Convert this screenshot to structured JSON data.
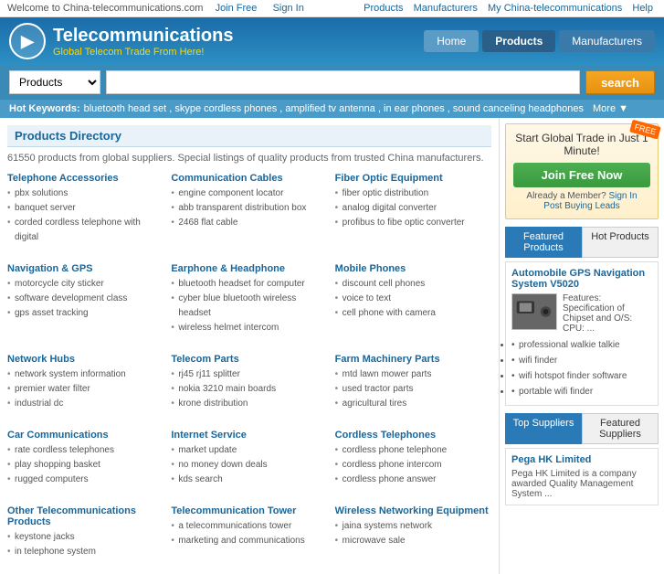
{
  "topbar": {
    "welcome": "Welcome to China-telecommunications.com",
    "links": [
      "Join Free",
      "Sign In"
    ],
    "nav_links": [
      "Products",
      "Manufacturers",
      "My China-telecommunications",
      "Help"
    ]
  },
  "header": {
    "logo_icon": "T",
    "logo_title": "Telecommunications",
    "logo_subtitle": "Global Telecom Trade From Here!",
    "nav": [
      "Home",
      "Products",
      "Manufacturers"
    ]
  },
  "search": {
    "select_value": "Products",
    "button_label": "search",
    "placeholder": ""
  },
  "hot_keywords": {
    "label": "Hot Keywords:",
    "keywords": [
      "bluetooth head set",
      "skype cordless phones",
      "amplified tv antenna",
      "in ear phones",
      "sound canceling headphones"
    ],
    "more": "More ▼"
  },
  "products_dir": {
    "title": "Products Directory",
    "desc": "61550 products from global suppliers. Special listings of quality products from trusted China manufacturers.",
    "categories": [
      {
        "title": "Telephone Accessories",
        "items": [
          "pbx solutions",
          "banquet server",
          "corded cordless telephone with digital"
        ]
      },
      {
        "title": "Communication Cables",
        "items": [
          "engine component locator",
          "abb transparent distribution box",
          "2468 flat cable"
        ]
      },
      {
        "title": "Fiber Optic Equipment",
        "items": [
          "fiber optic distribution",
          "analog digital converter",
          "profibus to fibe optic converter"
        ]
      },
      {
        "title": "Navigation & GPS",
        "items": [
          "motorcycle city sticker",
          "software development class",
          "gps asset tracking"
        ]
      },
      {
        "title": "Earphone & Headphone",
        "items": [
          "bluetooth headset for computer",
          "cyber blue bluetooth wireless headset",
          "wireless helmet intercom"
        ]
      },
      {
        "title": "Mobile Phones",
        "items": [
          "discount cell phones",
          "voice to text",
          "cell phone with camera"
        ]
      },
      {
        "title": "Network Hubs",
        "items": [
          "network system information",
          "premier water filter",
          "industrial dc"
        ]
      },
      {
        "title": "Telecom Parts",
        "items": [
          "rj45 rj11 splitter",
          "nokia 3210 main boards",
          "krone distribution"
        ]
      },
      {
        "title": "Farm Machinery Parts",
        "items": [
          "mtd lawn mower parts",
          "used tractor parts",
          "agricultural tires"
        ]
      },
      {
        "title": "Car Communications",
        "items": [
          "rate cordless telephones",
          "play shopping basket",
          "rugged computers"
        ]
      },
      {
        "title": "Internet Service",
        "items": [
          "market update",
          "no money down deals",
          "kds search"
        ]
      },
      {
        "title": "Cordless Telephones",
        "items": [
          "cordless phone telephone",
          "cordless phone intercom",
          "cordless phone answer"
        ]
      },
      {
        "title": "Other Telecommunications Products",
        "items": [
          "keystone jacks",
          "in telephone system"
        ]
      },
      {
        "title": "Telecommunication Tower",
        "items": [
          "a telecommunications tower",
          "marketing and communications"
        ]
      },
      {
        "title": "Wireless Networking Equipment",
        "items": [
          "jaina systems network",
          "microwave sale"
        ]
      }
    ]
  },
  "sidebar": {
    "join_title": "Start Global Trade in Just 1 Minute!",
    "join_btn": "Join Free Now",
    "join_sub": "Already a Member?",
    "sign_in": "Sign In",
    "post": "Post Buying Leads",
    "free_badge": "FREE",
    "featured_tabs": [
      "Featured Products",
      "Hot Products"
    ],
    "featured_product_title": "Automobile GPS Navigation System V5020",
    "featured_product_desc": "Features: Specification of Chipset and O/S: CPU: ...",
    "product_features": [
      "professional walkie talkie",
      "wifi finder",
      "wifi hotspot finder software",
      "portable wifi finder"
    ],
    "supplier_tabs": [
      "Top Suppliers",
      "Featured Suppliers"
    ],
    "supplier_name": "Pega HK Limited",
    "supplier_desc": "Pega HK Limited is a company awarded Quality Management System ..."
  }
}
